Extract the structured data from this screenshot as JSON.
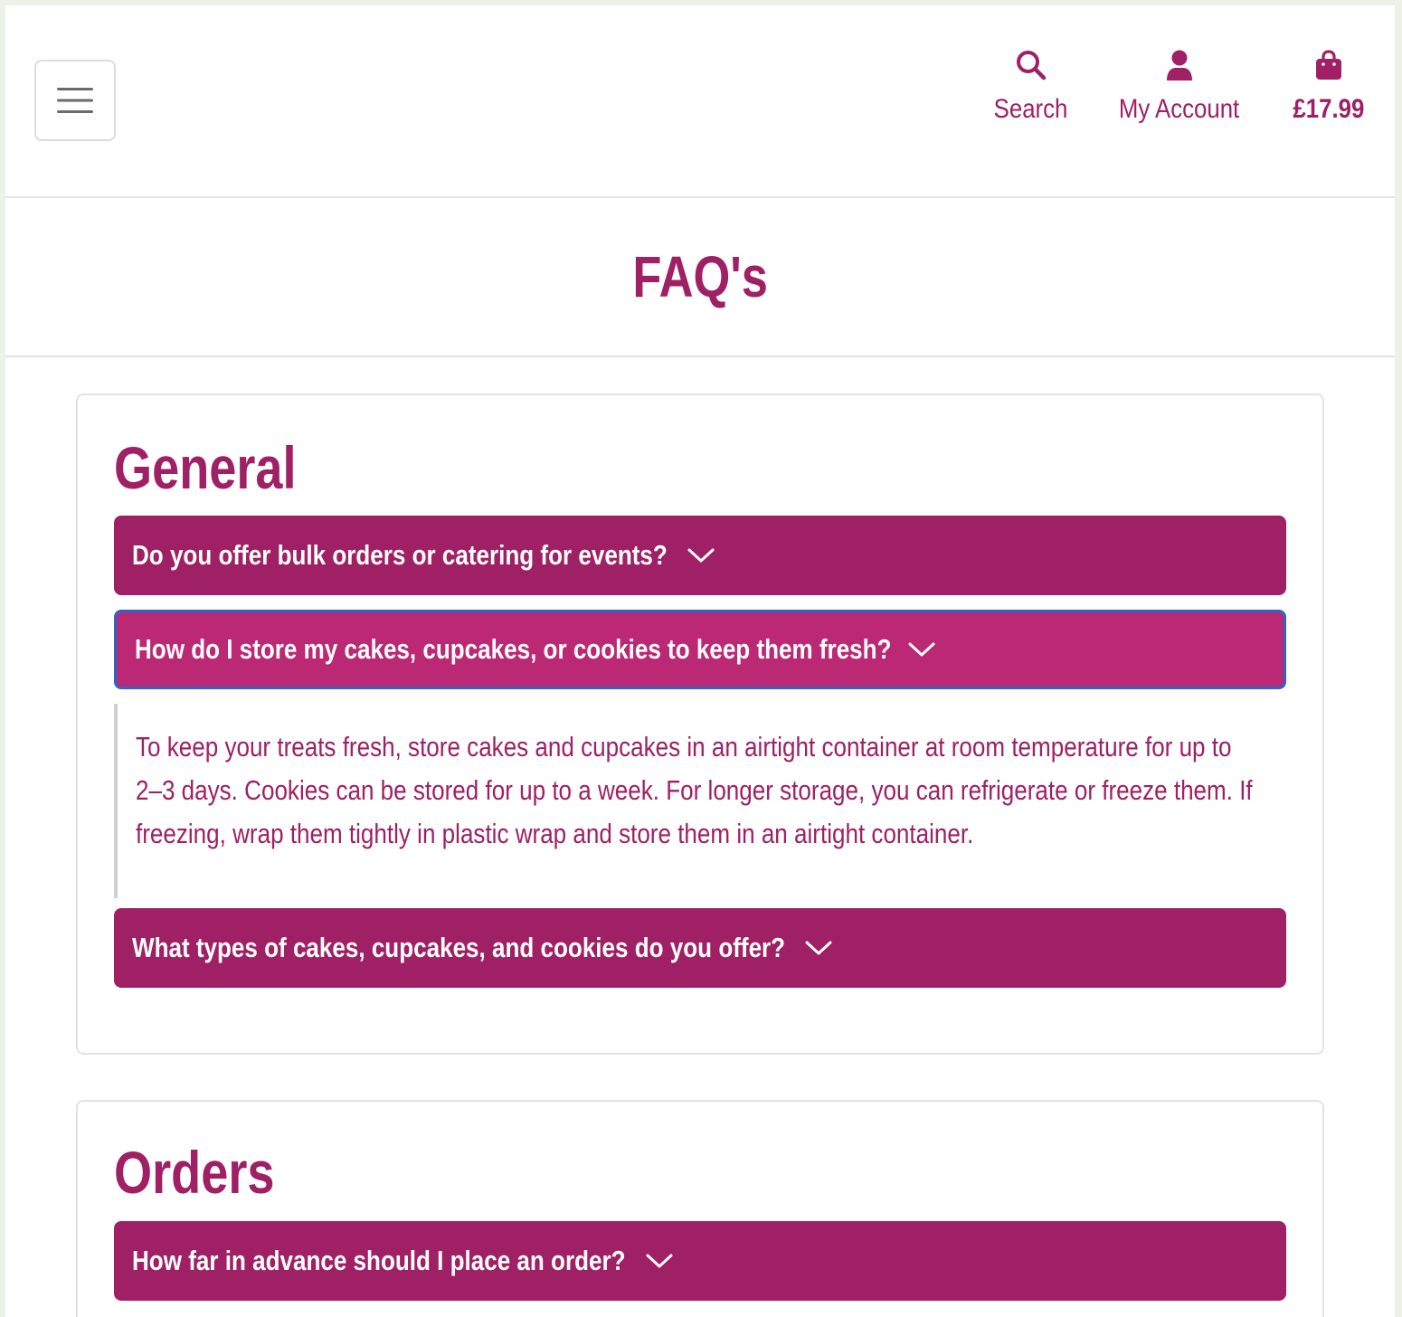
{
  "header": {
    "menu_icon": "hamburger-icon",
    "nav": {
      "search_label": "Search",
      "search_icon": "search-icon",
      "account_label": "My Account",
      "account_icon": "user-icon",
      "cart_total": "£17.99",
      "cart_icon": "shopping-bag-icon"
    }
  },
  "page_title": "FAQ's",
  "sections": [
    {
      "heading": "General",
      "questions": [
        {
          "question": "Do you offer bulk orders or catering for events?",
          "expanded": false
        },
        {
          "question": "How do I store my cakes, cupcakes, or cookies to keep them fresh?",
          "expanded": true,
          "answer": "To keep your treats fresh, store cakes and cupcakes in an airtight container at room temperature for up to 2–3 days. Cookies can be stored for up to a week. For longer storage, you can refrigerate or freeze them. If freezing, wrap them tightly in plastic wrap and store them in an airtight container."
        },
        {
          "question": "What types of cakes, cupcakes, and cookies do you offer?",
          "expanded": false
        }
      ]
    },
    {
      "heading": "Orders",
      "questions": [
        {
          "question": "How far in advance should I place an order?",
          "expanded": false
        }
      ]
    }
  ],
  "colors": {
    "brand": "#9f2064",
    "brand_active": "#bb2874",
    "focus_ring": "#2f63c8",
    "border": "#e3e3e3",
    "outer_background": "#eef1e8"
  }
}
